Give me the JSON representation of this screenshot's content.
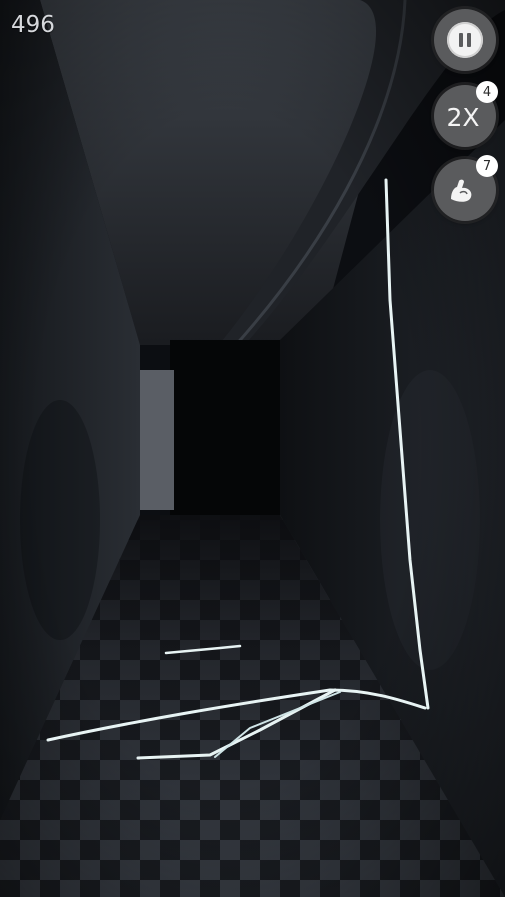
{
  "hud": {
    "score": "496",
    "double_label": "2X",
    "double_count": "4",
    "strength_count": "7"
  },
  "icons": {
    "pause": "pause-icon",
    "strength": "flexed-arm-icon"
  },
  "colors": {
    "button_bg": "#5a5b5d",
    "button_fg": "#f4f4f4",
    "badge_bg": "#ffffff",
    "trail": "#e8f4f4"
  }
}
